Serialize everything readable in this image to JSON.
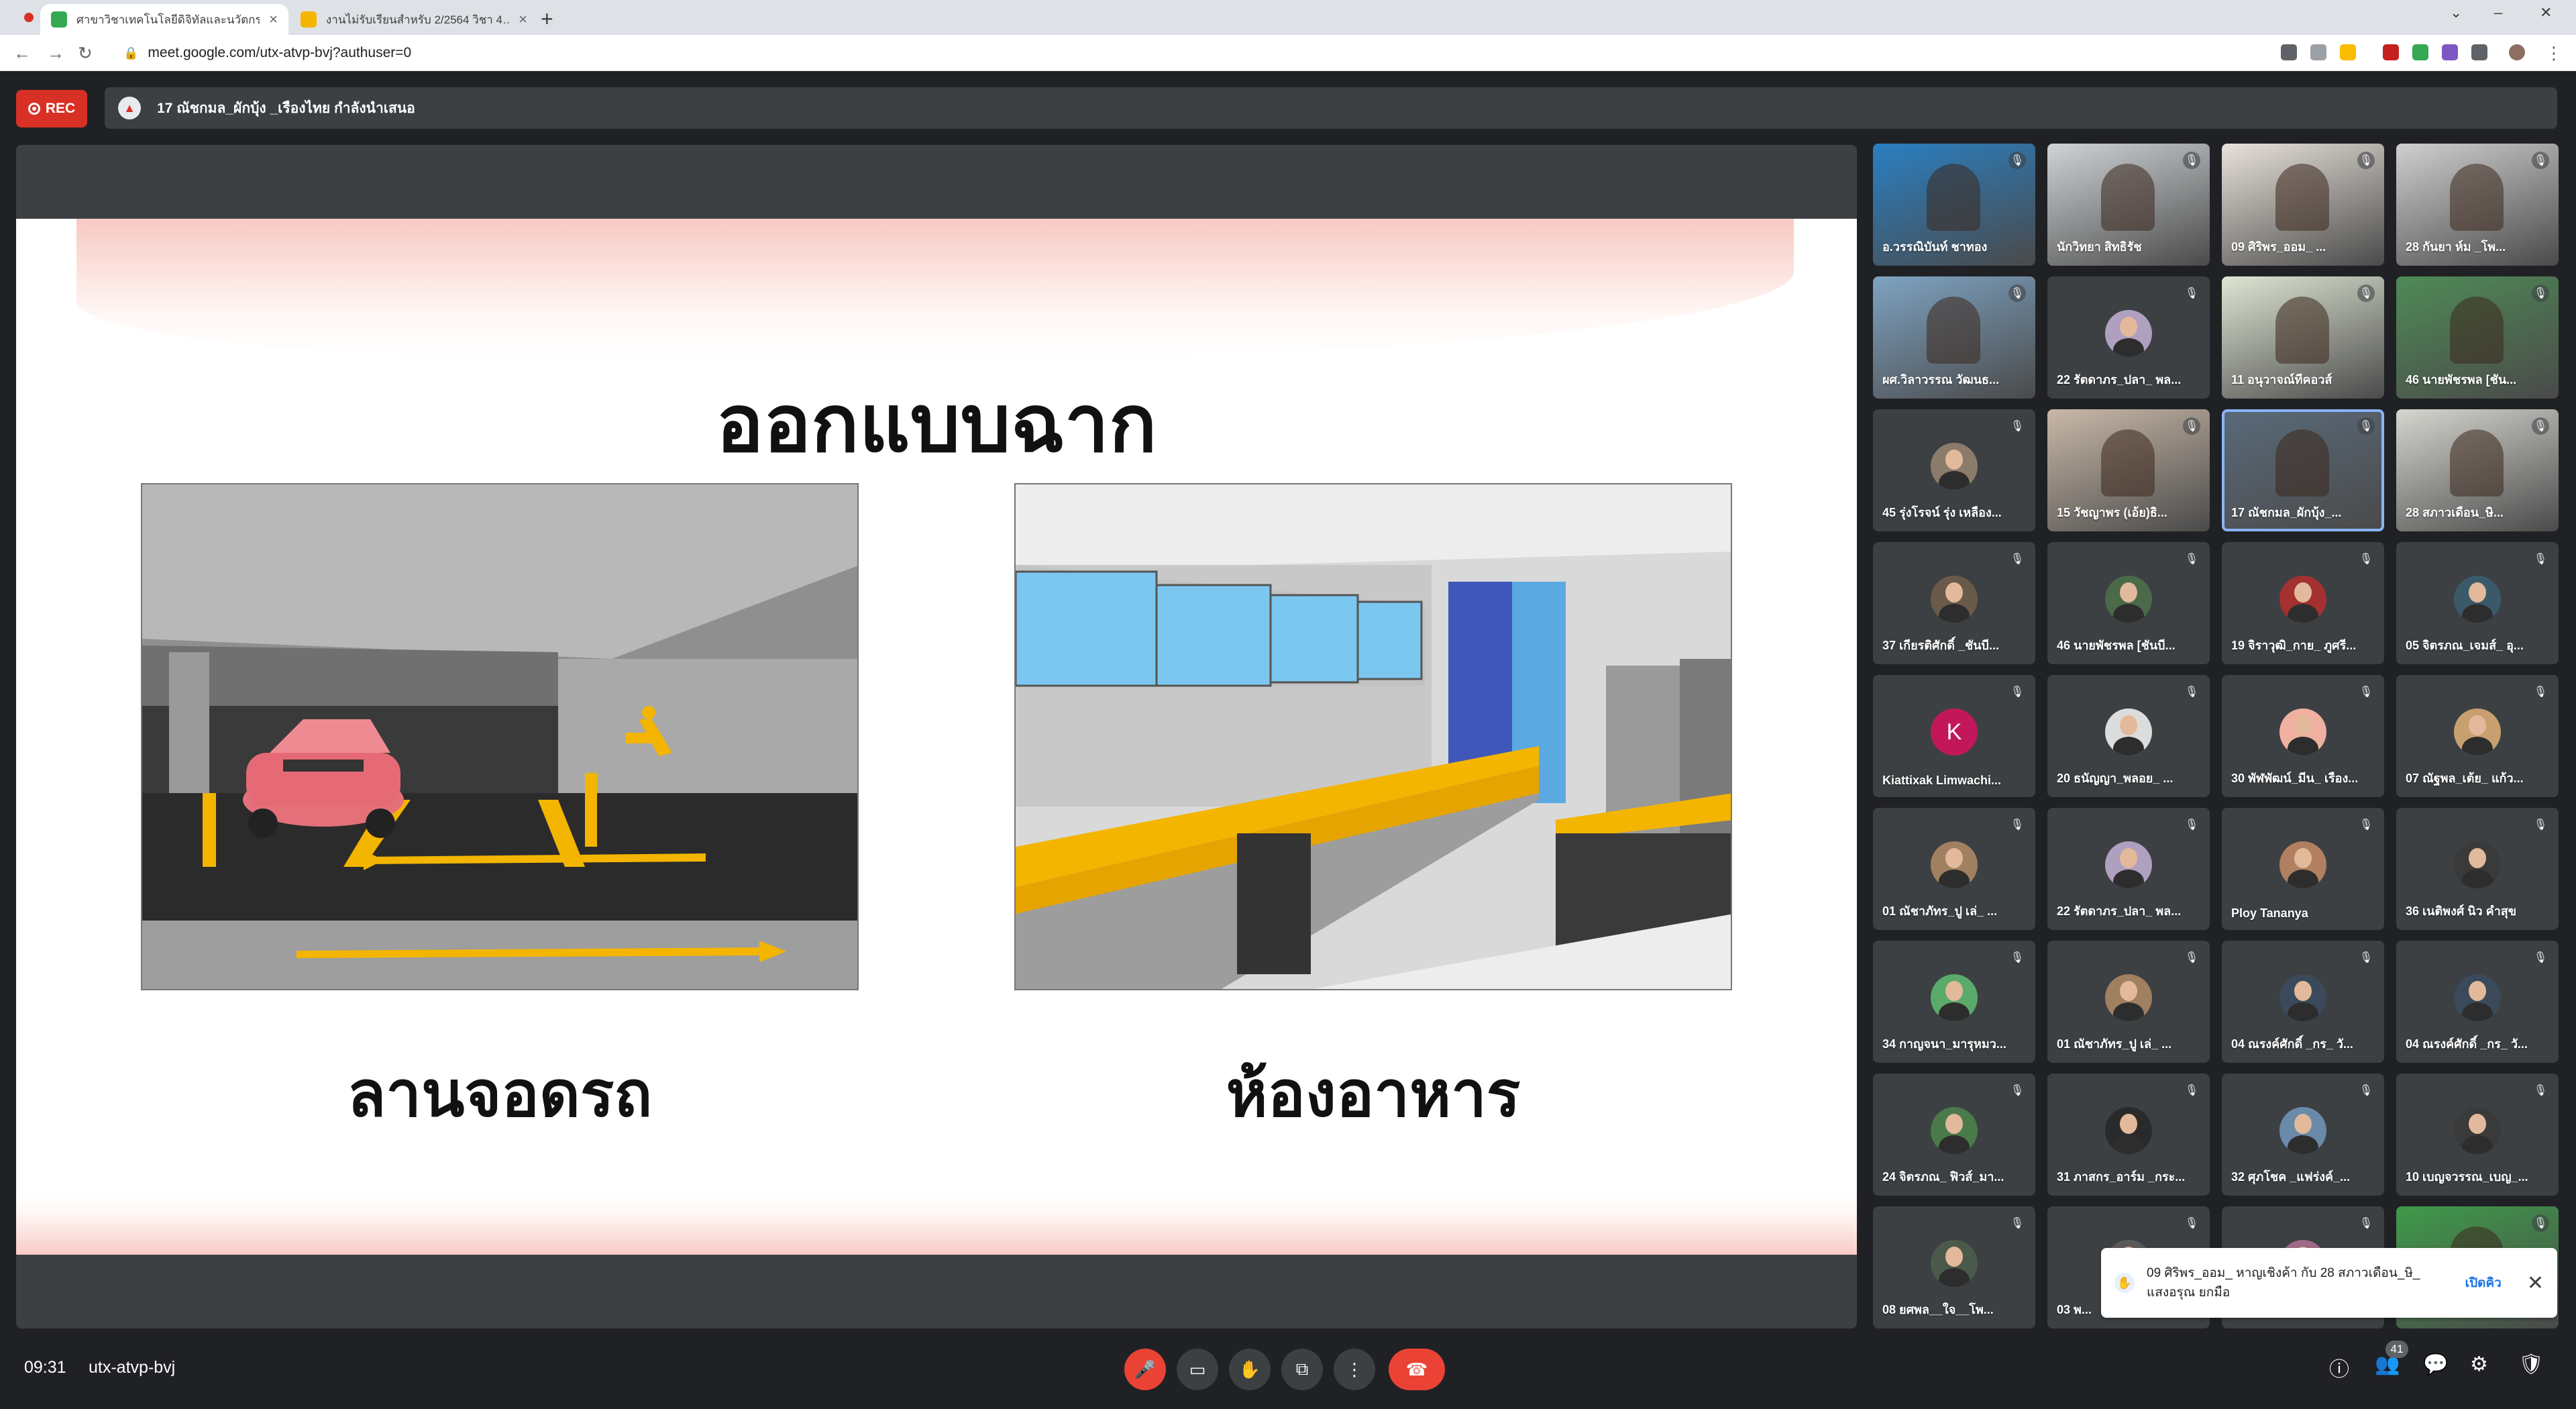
{
  "browser": {
    "tabs": [
      {
        "title": "ศาขาวิชาเทคโนโลยีดิจิทัลและนวัตกรรม",
        "active": true
      },
      {
        "title": "งานไม่รับเรียนสำหรับ 2/2564 วิชา 4…",
        "active": false
      }
    ],
    "url": "meet.google.com/utx-atvp-bvj?authuser=0"
  },
  "meet": {
    "rec_label": "REC",
    "presenting_text": "17 ณัชกมล_ผักบุ้ง _เรืองไทย กำลังนำเสนอ",
    "time": "09:31",
    "meeting_code": "utx-atvp-bvj",
    "participant_count": "41"
  },
  "slide": {
    "title": "ออกแบบฉาก",
    "left_caption": "ลานจอดรถ",
    "right_caption": "ห้องอาหาร"
  },
  "participants": [
    {
      "name": "อ.วรรณิบันท์ ชาทอง",
      "type": "video",
      "bg": "#2a7fc2"
    },
    {
      "name": "นักวิทยา สิทธิรัช",
      "type": "video",
      "bg": "#cfd3d6"
    },
    {
      "name": "09 ศิริพร_ออม_ ...",
      "type": "video",
      "bg": "#e8e2da"
    },
    {
      "name": "28 กันยา ห์ม _โพ...",
      "type": "video",
      "bg": "#cfcfcf"
    },
    {
      "name": "ผศ.วิลาวรรณ วัฒนธ...",
      "type": "video",
      "bg": "#7ea3c2"
    },
    {
      "name": "22 รัตดาภร_ปลา_ พล...",
      "type": "avatar",
      "bg": "#b0a0c0"
    },
    {
      "name": "11 อนุวาจณ์ทีคอวส์",
      "type": "video",
      "bg": "#dfe6d4"
    },
    {
      "name": "46 นายพัชรพล [ชัน...",
      "type": "video",
      "bg": "#4f8a56"
    },
    {
      "name": "45 รุ่งโรจน์ รุ่ง เหลือง...",
      "type": "avatar",
      "bg": "#8b7b6b"
    },
    {
      "name": "15 วัชญาพร (เอ้ย)ธิ...",
      "type": "video",
      "bg": "#c9b8a8"
    },
    {
      "name": "17 ณัชกมล_ผักบุ้ง_...",
      "type": "video",
      "bg": "#5a6a7a",
      "speaking": true
    },
    {
      "name": "28 สภาวเดือน_ษิ...",
      "type": "video",
      "bg": "#d6d6d0"
    },
    {
      "name": "37 เกียรติศักดิ์ _ชันบี...",
      "type": "avatar",
      "bg": "#6a5a4a"
    },
    {
      "name": "46 นายพัชรพล [ชันบี...",
      "type": "avatar",
      "bg": "#4a6a4a"
    },
    {
      "name": "19 จิราวุฒิ_กาย_ ภูศรี...",
      "type": "avatar",
      "bg": "#a43030"
    },
    {
      "name": "05 จิตรภณ_เจมส์_ อุ...",
      "type": "avatar",
      "bg": "#3a5a6a"
    },
    {
      "name": "Kiattixak Limwachi...",
      "type": "letter",
      "letter": "K",
      "bg": "#c2185b"
    },
    {
      "name": "20 ธนัญญา_พลอย_ ...",
      "type": "avatar",
      "bg": "#dcdcdc"
    },
    {
      "name": "30 พัฬพัฒน์_มีน_ เรือง...",
      "type": "avatar",
      "bg": "#f0b0a0"
    },
    {
      "name": "07 ณัฐพล_เต้ย_ แก้ว...",
      "type": "avatar",
      "bg": "#c8a070"
    },
    {
      "name": "01 ณัชาภัทร_ปู เล่_ ...",
      "type": "avatar",
      "bg": "#a08060"
    },
    {
      "name": "22 รัตดาภร_ปลา_ พล...",
      "type": "avatar",
      "bg": "#b0a0c0"
    },
    {
      "name": "Ploy Tananya",
      "type": "avatar",
      "bg": "#b08060"
    },
    {
      "name": "36 เนติพงศ์ นิว คำสุข",
      "type": "avatar",
      "bg": "#3a3a3a"
    },
    {
      "name": "34 กาญจนา_มารุหมว...",
      "type": "avatar",
      "bg": "#5aaa6a"
    },
    {
      "name": "01 ณัชาภัทร_ปู เล่_ ...",
      "type": "avatar",
      "bg": "#a08060"
    },
    {
      "name": "04 ณรงค์ศักดิ์ _กร_ วั...",
      "type": "avatar",
      "bg": "#3a4a5a"
    },
    {
      "name": "04 ณรงค์ศักดิ์ _กร_ วั...",
      "type": "avatar",
      "bg": "#3a4a5a"
    },
    {
      "name": "24 จิตรภณ_ ฟิวส์_มา...",
      "type": "avatar",
      "bg": "#4a7a4a"
    },
    {
      "name": "31 ภาสกร_อาร์ม _กระ...",
      "type": "avatar",
      "bg": "#2a2a2a"
    },
    {
      "name": "32 ศุภโชค _แฟร่งค์_...",
      "type": "avatar",
      "bg": "#6a8aaa"
    },
    {
      "name": "10 เบญจวรรณ_เบญ_...",
      "type": "avatar",
      "bg": "#3a3a3a"
    },
    {
      "name": "08 ยศพล__ใจ__โพ...",
      "type": "avatar",
      "bg": "#4a5a4a"
    },
    {
      "name": "03 พ...",
      "type": "avatar",
      "bg": "#5a5a5a"
    },
    {
      "name": "",
      "type": "avatar",
      "bg": "#a06a8a"
    },
    {
      "name": "",
      "type": "video",
      "bg": "#3f9a4a"
    }
  ],
  "toast": {
    "message": "09 ศิริพร_ออม_ หาญเชิงค้า กับ 28 สภาวเดือน_ษิ_ แสงอรุณ ยกมือ",
    "action": "เปิดคิว"
  },
  "colors": {
    "rec": "#d93025",
    "end_call": "#ea4335",
    "accent": "#1a73e8",
    "meet_bg": "#202124"
  }
}
